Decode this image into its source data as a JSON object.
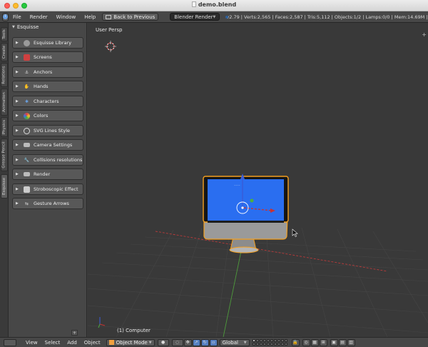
{
  "window": {
    "title": "demo.blend"
  },
  "topbar": {
    "menus": [
      "File",
      "Render",
      "Window",
      "Help"
    ],
    "back_button": "Back to Previous",
    "engine": "Blender Render",
    "stats": "v2.79 | Verts:2,565 | Faces:2,587 | Tris:5,112 | Objects:1/2 | Lamps:0/0 | Mem:14.69M | Comp"
  },
  "vertical_tabs": [
    "Tools",
    "Create",
    "Relations",
    "Animation",
    "Physics",
    "Grease Pencil",
    "Esquisse"
  ],
  "shelf": {
    "header": "Esquisse",
    "items": [
      {
        "label": "Esquisse Library",
        "icon": "library-icon"
      },
      {
        "label": "Screens",
        "icon": "screens-icon"
      },
      {
        "label": "Anchors",
        "icon": "anchors-icon"
      },
      {
        "label": "Hands",
        "icon": "hands-icon"
      },
      {
        "label": "Characters",
        "icon": "characters-icon"
      },
      {
        "label": "Colors",
        "icon": "colors-icon"
      },
      {
        "label": "SVG Lines Style",
        "icon": "svg-lines-icon"
      },
      {
        "label": "Camera Settings",
        "icon": "camera-icon"
      },
      {
        "label": "Collisions resolutions",
        "icon": "collisions-icon"
      },
      {
        "label": "Render",
        "icon": "render-icon"
      },
      {
        "label": "Stroboscopic Effect",
        "icon": "stroboscopic-icon"
      },
      {
        "label": "Gesture Arrows",
        "icon": "gesture-arrows-icon"
      }
    ]
  },
  "viewport": {
    "view_label": "User Persp",
    "object_label": "(1) Computer"
  },
  "bottombar": {
    "menus": [
      "View",
      "Select",
      "Add",
      "Object"
    ],
    "mode": "Object Mode",
    "orientation": "Global"
  },
  "colors": {
    "screen_blue": "#2a6ef0",
    "selection_orange": "#f5a020",
    "axis_red": "#c83232",
    "axis_green": "#4cb040",
    "axis_blue": "#3a5cd6"
  }
}
